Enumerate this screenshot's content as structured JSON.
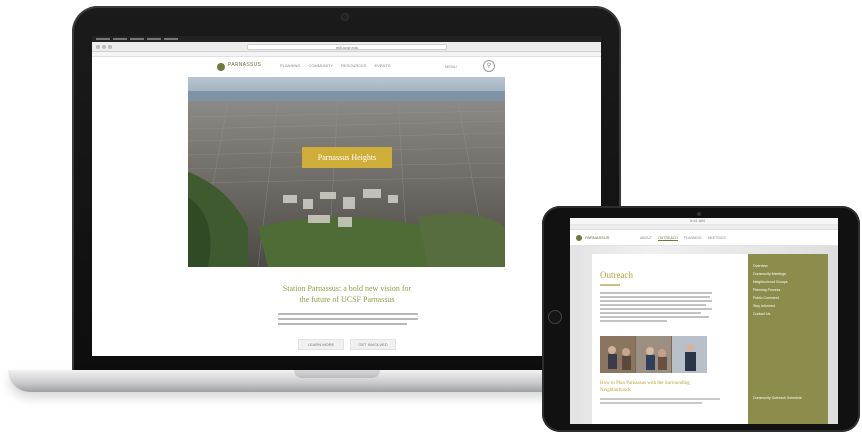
{
  "laptop": {
    "browser": {
      "url": "mill.ucsf.edu",
      "bookmarks": ""
    },
    "site": {
      "logo_text": "PARNASSUS",
      "nav": [
        "PLANNING",
        "COMMUNITY",
        "RESOURCES",
        "EVENTS"
      ],
      "menu_label": "MENU",
      "search_icon": "search-icon",
      "hero_badge": "Parnassus Heights",
      "headline_line1": "Station Parnassus: a bold new vision for",
      "headline_line2": "the future of UCSF Parnassus",
      "button_1": "LEARN MORE",
      "button_2": "GET INVOLVED"
    }
  },
  "tablet": {
    "status_time": "9:41 AM",
    "site": {
      "logo_text": "PARNASSUS",
      "nav": [
        "ABOUT",
        "OUTREACH",
        "PLANNING",
        "MEETINGS"
      ],
      "page_title": "Outreach",
      "section_heading": "How to Plan Parnassus with the Surrounding Neighborhoods",
      "sidebar_items": [
        "Overview",
        "Community Meetings",
        "Neighborhood Groups",
        "Planning Process",
        "Public Comment",
        "Stay Informed",
        "Contact Us"
      ],
      "sidebar_footer": "Community Outreach Schedule"
    }
  },
  "colors": {
    "brand_olive": "#6d7a3a",
    "hero_badge": "#d6b234",
    "headline_green": "#8fa04a",
    "sidebar_olive": "#8c8d4d",
    "title_gold": "#b5a33c"
  }
}
